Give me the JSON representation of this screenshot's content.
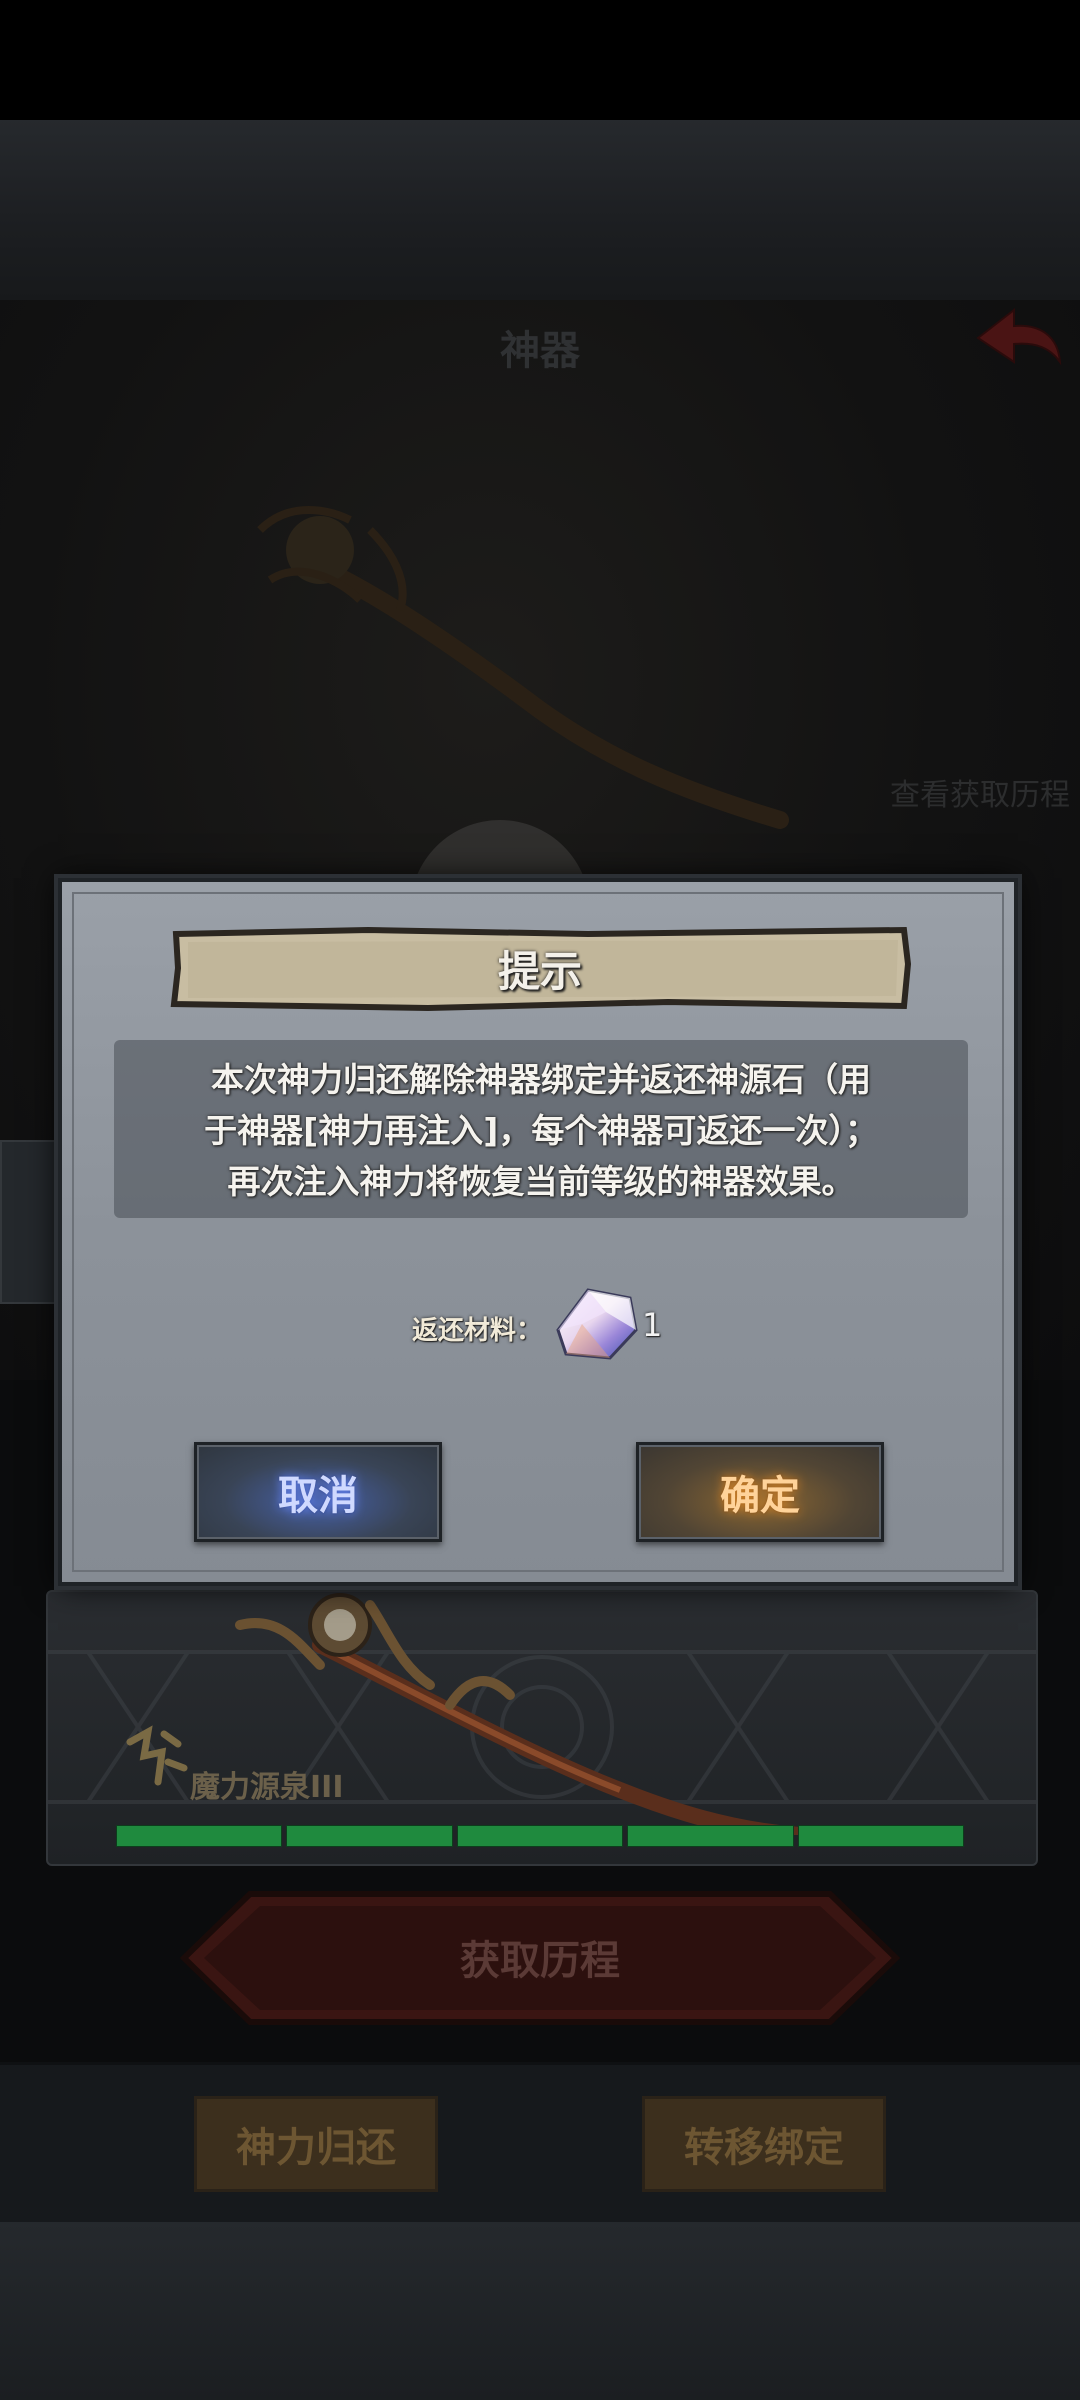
{
  "screen": {
    "title": "神器",
    "view_history": "查看获取历程"
  },
  "equipment": {
    "skill_name": "魔力源泉III",
    "progress_segments_filled": 5,
    "progress_segments_total": 5
  },
  "history_button": {
    "label": "获取历程"
  },
  "bottom_actions": {
    "return_label": "神力归还",
    "transfer_label": "转移绑定"
  },
  "dialog": {
    "title": "提示",
    "message_lines": [
      "本次神力归还解除神器绑定并返还神源石（用",
      "于神器[神力再注入]，每个神器可返还一次）；",
      "再次注入神力将恢复当前等级的神器效果。"
    ],
    "reward_label": "返还材料：",
    "reward_icon": "crystal-icon",
    "reward_count": "1",
    "cancel_label": "取消",
    "confirm_label": "确定"
  },
  "colors": {
    "overlay_bg": "#0b0c0d",
    "dialog_bg": "#8c929a",
    "progress": "#1f8a3e",
    "cancel_glow": "#6b8cff",
    "confirm_glow": "#e08b2a"
  }
}
